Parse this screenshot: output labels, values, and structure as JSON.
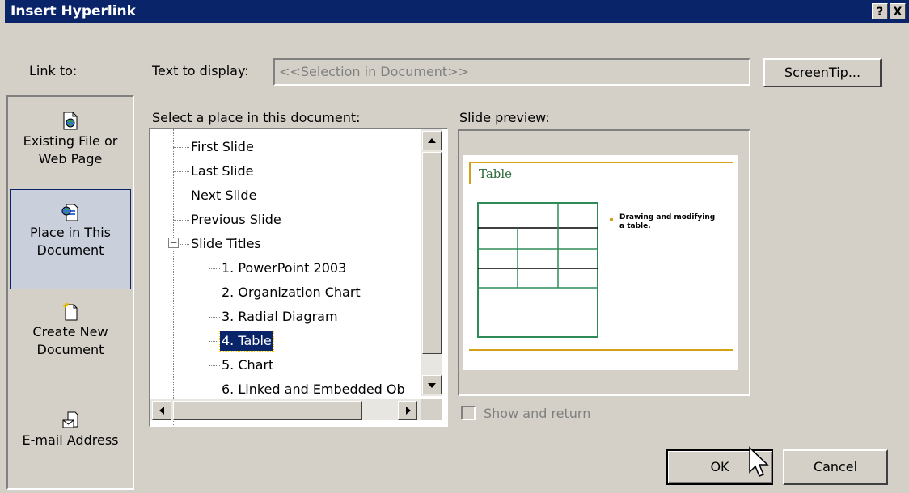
{
  "window": {
    "title": "Insert Hyperlink",
    "help_button": "?",
    "close_button": "X"
  },
  "link_to": {
    "label": "Link to:",
    "items": [
      {
        "label_line1": "Existing File or",
        "label_line2": "Web Page",
        "icon": "file-web-icon",
        "selected": false
      },
      {
        "label_line1": "Place in This",
        "label_line2": "Document",
        "icon": "place-in-document-icon",
        "selected": true
      },
      {
        "label_line1": "Create New",
        "label_line2": "Document",
        "icon": "new-document-icon",
        "selected": false
      },
      {
        "label_line1": "E-mail Address",
        "label_line2": "",
        "icon": "email-icon",
        "selected": false
      }
    ]
  },
  "text_to_display": {
    "label": "Text to display:",
    "value": "<<Selection in Document>>"
  },
  "screentip_button": "ScreenTip...",
  "place_list": {
    "label": "Select a place in this document:",
    "top_items": [
      "First Slide",
      "Last Slide",
      "Next Slide",
      "Previous Slide"
    ],
    "group_label": "Slide Titles",
    "group_expander": "−",
    "slides": [
      "1. PowerPoint 2003",
      "2. Organization Chart",
      "3. Radial Diagram",
      "4. Table",
      "5. Chart",
      "6. Linked and Embedded Ob"
    ],
    "selected": "4. Table"
  },
  "slide_preview": {
    "label": "Slide preview:",
    "slide_title": "Table",
    "bullet_text_line1": "Drawing and modifying",
    "bullet_text_line2": "a table.",
    "colors": {
      "table_lines": "#2e8b57",
      "rule": "#d4a017",
      "title": "#2e6b3e"
    }
  },
  "show_and_return": {
    "label": "Show and return",
    "checked": false,
    "enabled": false
  },
  "buttons": {
    "ok": "OK",
    "cancel": "Cancel"
  }
}
